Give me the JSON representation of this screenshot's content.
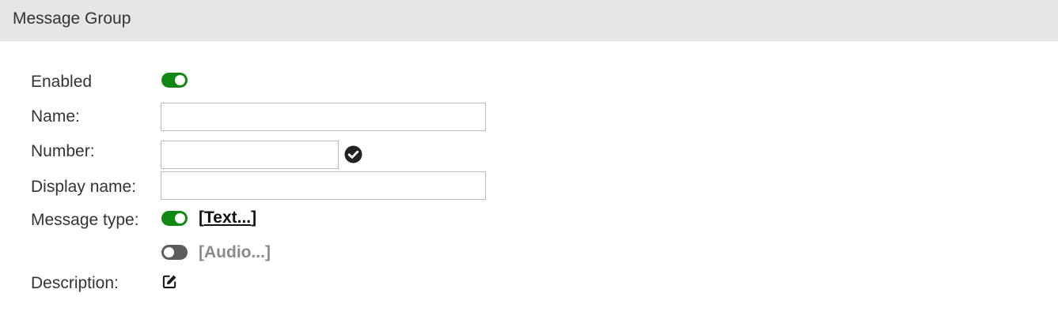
{
  "header": {
    "title": "Message Group"
  },
  "form": {
    "enabled": {
      "label": "Enabled",
      "state": "on"
    },
    "name": {
      "label": "Name:",
      "value": "",
      "placeholder": ""
    },
    "number": {
      "label": "Number:",
      "value": "",
      "placeholder": "",
      "validate_icon": "check-circle-icon"
    },
    "display_name": {
      "label": "Display name:",
      "value": "",
      "placeholder": ""
    },
    "message_type": {
      "label": "Message type:",
      "text": {
        "open": "[",
        "link": "Text...",
        "close": "]",
        "state": "on"
      },
      "audio": {
        "text": "[Audio...]",
        "state": "off"
      }
    },
    "description": {
      "label": "Description:",
      "edit_icon": "edit-icon"
    }
  },
  "colors": {
    "toggle_on": "#118811",
    "toggle_off": "#5c5c5c",
    "header_bg": "#e6e6e6"
  }
}
